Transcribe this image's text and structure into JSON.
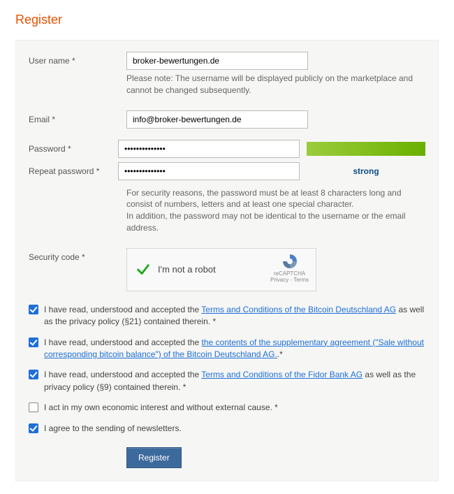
{
  "title": "Register",
  "fields": {
    "username": {
      "label": "User name *",
      "value": "broker-bewertungen.de",
      "helper": "Please note: The username will be displayed publicly on the marketplace and cannot be changed subsequently."
    },
    "email": {
      "label": "Email *",
      "value": "info@broker-bewertungen.de"
    },
    "password": {
      "label": "Password *",
      "value": "••••••••••••••"
    },
    "repeat": {
      "label": "Repeat password *",
      "value": "••••••••••••••",
      "helper": "For security reasons, the password must be at least 8 characters long and consist of numbers, letters and at least one special character.\nIn addition, the password may not be identical to the username or the email address."
    },
    "strength": {
      "text": "strong"
    },
    "captcha": {
      "label": "Security code *",
      "text": "I'm not a robot",
      "rc1": "reCAPTCHA",
      "rc2": "Privacy - Terms"
    }
  },
  "checks": {
    "c1": {
      "pre": "I have read, understood and accepted the ",
      "link": "Terms and Conditions of the Bitcoin Deutschland AG",
      "post": " as well as the privacy policy (§21) contained therein. *",
      "checked": true
    },
    "c2": {
      "pre": "I have read, understood and accepted the ",
      "link": "the contents of the supplementary agreement (\"Sale without corresponding bitcoin balance\") of the Bitcoin Deutschland AG.",
      "post": ".*",
      "checked": true
    },
    "c3": {
      "pre": "I have read, understood and accepted the ",
      "link": "Terms and Conditions of the Fidor Bank AG",
      "post": " as well as the privacy policy (§9) contained therein. *",
      "checked": true
    },
    "c4": {
      "text": "I act in my own economic interest and without external cause. *",
      "checked": false
    },
    "nl": {
      "text": "I agree to the sending of newsletters.",
      "checked": true
    }
  },
  "submit": "Register"
}
